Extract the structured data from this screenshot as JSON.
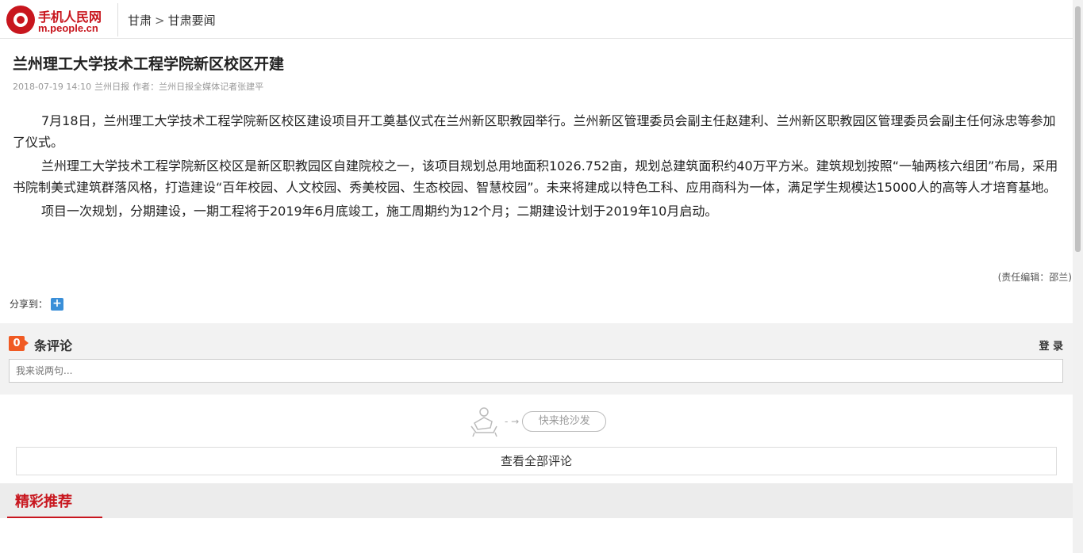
{
  "header": {
    "logo_name": "手机人民网",
    "logo_url": "m.people.cn",
    "breadcrumb": [
      "甘肃",
      "甘肃要闻"
    ],
    "breadcrumb_sep": ">"
  },
  "article": {
    "title": "兰州理工大学技术工程学院新区校区开建",
    "date": "2018-07-19 14:10",
    "source": "兰州日报",
    "author": "作者：兰州日报全媒体记者张建平",
    "paragraphs": [
      "7月18日，兰州理工大学技术工程学院新区校区建设项目开工奠基仪式在兰州新区职教园举行。兰州新区管理委员会副主任赵建利、兰州新区职教园区管理委员会副主任何泳忠等参加了仪式。",
      "兰州理工大学技术工程学院新区校区是新区职教园区自建院校之一，该项目规划总用地面积1026.752亩，规划总建筑面积约40万平方米。建筑规划按照“一轴两核六组团”布局，采用书院制美式建筑群落风格，打造建设“百年校园、人文校园、秀美校园、生态校园、智慧校园”。未来将建成以特色工科、应用商科为一体，满足学生规模达15000人的高等人才培育基地。",
      "项目一次规划，分期建设，一期工程将于2019年6月底竣工，施工周期约为12个月；二期建设计划于2019年10月启动。"
    ],
    "editor": "(责任编辑：邵兰)",
    "share_label": "分享到："
  },
  "comments": {
    "count": "0",
    "label": "条评论",
    "login": "登 录",
    "placeholder": "我来说两句...",
    "sofa_button": "快来抢沙发",
    "view_all": "查看全部评论"
  },
  "recommend": {
    "title": "精彩推荐"
  },
  "colors": {
    "brand_red": "#c8161e",
    "badge_orange": "#f05a23",
    "share_blue": "#3a8fd8"
  }
}
